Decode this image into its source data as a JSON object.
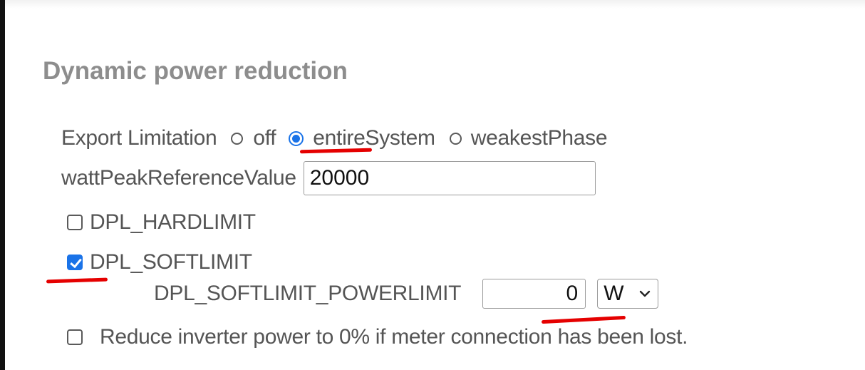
{
  "section": {
    "title": "Dynamic power reduction"
  },
  "export_limitation": {
    "label": "Export Limitation",
    "options": [
      {
        "label": "off",
        "selected": false
      },
      {
        "label": "entireSystem",
        "selected": true
      },
      {
        "label": "weakestPhase",
        "selected": false
      }
    ]
  },
  "watt_peak": {
    "label": "wattPeakReferenceValue",
    "value": "20000"
  },
  "dpl_hardlimit": {
    "label": "DPL_HARDLIMIT",
    "checked": false
  },
  "dpl_softlimit": {
    "label": "DPL_SOFTLIMIT",
    "checked": true
  },
  "dpl_softlimit_powerlimit": {
    "label": "DPL_SOFTLIMIT_POWERLIMIT",
    "value": "0",
    "unit": "W"
  },
  "reduce_on_meter_loss": {
    "label": "Reduce inverter power to 0% if meter connection has been lost.",
    "checked": false
  },
  "colors": {
    "accent": "#1a73e8",
    "annotation": "#e50000",
    "title": "#8d8d8d",
    "text": "#555555"
  }
}
